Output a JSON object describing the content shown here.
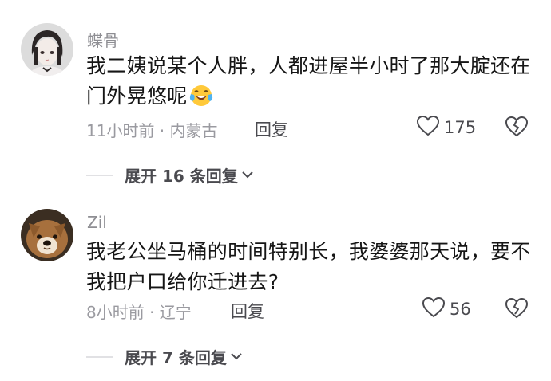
{
  "comments": [
    {
      "username": "蝶骨",
      "text": "我二姨说某个人胖，人都进屋半小时了那大腚还在门外晃悠呢",
      "emoji": "laughing-tears-emoji",
      "meta": "11小时前 · 内蒙古",
      "reply_label": "回复",
      "likes": "175",
      "expand_label": "展开 16 条回复"
    },
    {
      "username": "Zil",
      "text": "我老公坐马桶的时间特别长，我婆婆那天说，要不我把户口给你迁进去?",
      "meta": "8小时前 · 辽宁",
      "reply_label": "回复",
      "likes": "56",
      "expand_label": "展开 7 条回复"
    }
  ],
  "icons": {
    "like": "heart-outline-icon",
    "dislike": "broken-heart-icon",
    "expand": "chevron-down-icon"
  },
  "colors": {
    "text": "#161616",
    "secondary": "#9a9aa0",
    "action": "#4a4a4f"
  }
}
